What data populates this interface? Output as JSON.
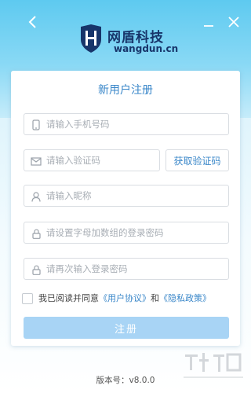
{
  "window": {
    "back_icon": "chevron-left-icon",
    "minimize_icon": "minimize-icon",
    "close_icon": "close-icon"
  },
  "brand": {
    "name": "网盾科技",
    "domain": "wangdun.cn",
    "color": "#17356a"
  },
  "form": {
    "title": "新用户注册",
    "phone_placeholder": "请输入手机号码",
    "code_placeholder": "请输入验证码",
    "get_code_label": "获取验证码",
    "nickname_placeholder": "请输入昵称",
    "password_placeholder": "请设置字母加数组的登录密码",
    "confirm_password_placeholder": "请再次输入登录密码",
    "agree_prefix": "我已阅读并同意",
    "user_agreement": "《用户协议》",
    "agree_and": "和",
    "privacy_policy": "《隐私政策》",
    "agreement_checked": false,
    "submit_label": "注册"
  },
  "footer": {
    "version": "版本号：v8.0.0"
  },
  "colors": {
    "accent": "#3a87c9",
    "submit_disabled": "#a8d4f5",
    "header": "#5ecaf0"
  }
}
